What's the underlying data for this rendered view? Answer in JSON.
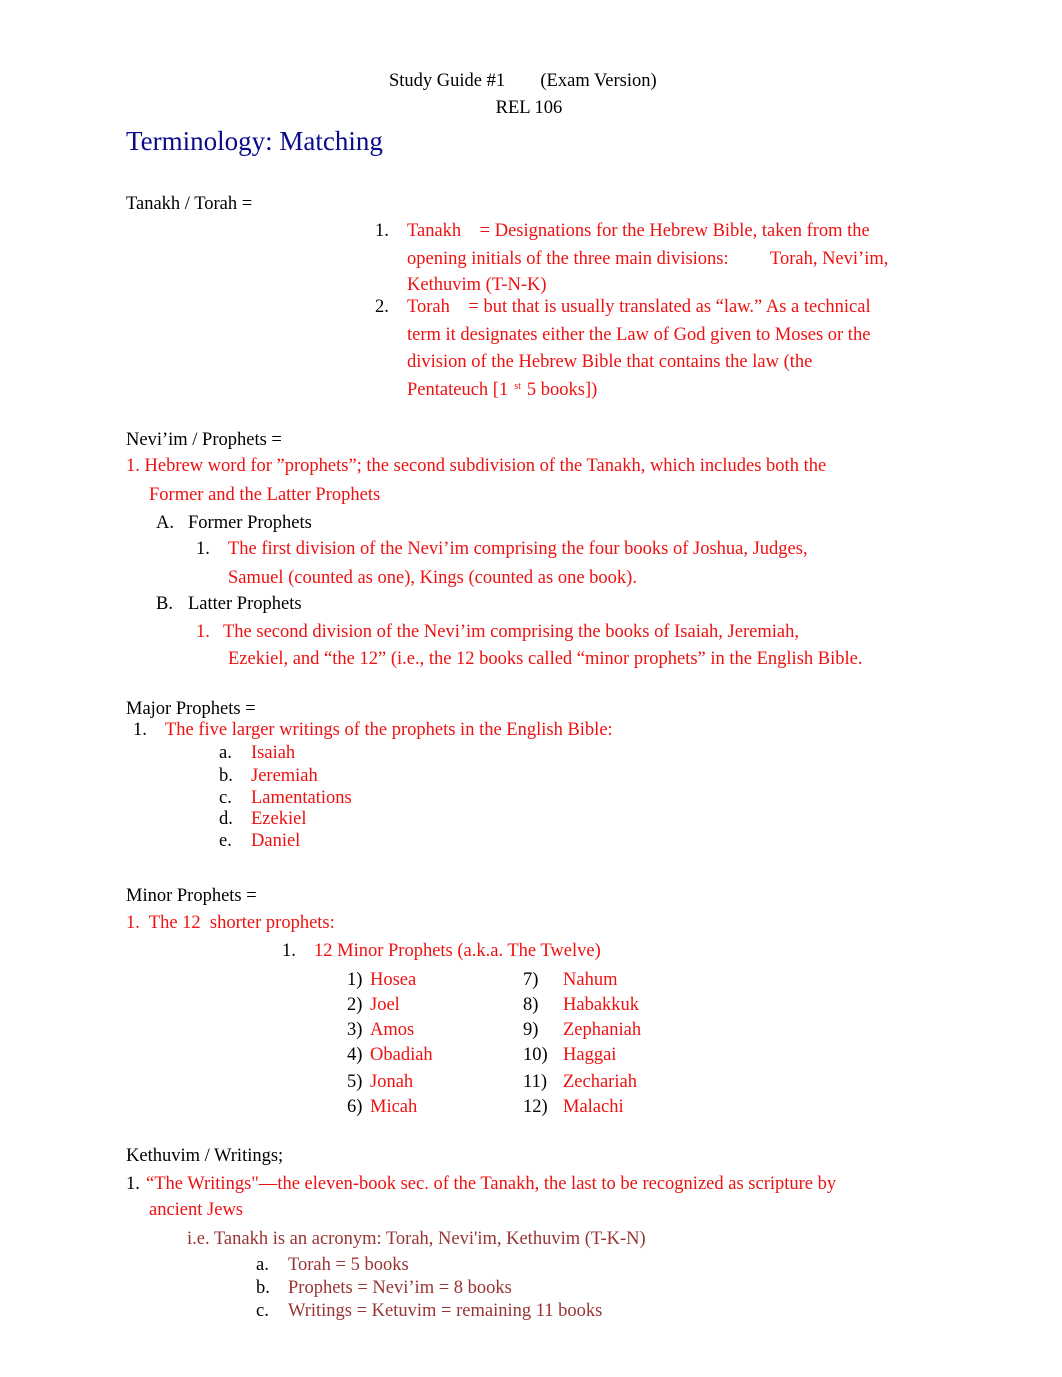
{
  "header": {
    "line1_a": "Study Guide #1",
    "line1_b": "(Exam Version)",
    "line2": "REL 106"
  },
  "section_title": "Terminology: Matching",
  "colors": {
    "title": "#0a0a8c",
    "answer": "#ee1111",
    "note": "#993333",
    "term": "#000000"
  },
  "tanakh": {
    "term": "Tanakh / Torah =",
    "items": [
      {
        "num": "1.",
        "lines": [
          "Tanakh    = Designations for the Hebrew Bible, taken from the",
          "opening initials of the three main divisions:         Torah, Nevi’im,",
          "Kethuvim (T-N-K)"
        ]
      },
      {
        "num": "2.",
        "lines": [
          "Torah    = but that is usually translated as “law.” As a technical",
          "term it designates either the Law of God given to Moses or the",
          "division of the Hebrew Bible that contains the law (the"
        ],
        "last_line_pre": "Pentateuch [1",
        "last_line_sup": "st",
        "last_line_post": "5 books])"
      }
    ]
  },
  "neviim": {
    "term": "Nevi’im / Prophets =",
    "def_line1": "1. Hebrew word for ”prophets”; the second subdivision of the Tanakh, which includes both the",
    "def_line2": "Former and the Latter Prophets",
    "sub": [
      {
        "letter": "A.",
        "label": "Former Prophets",
        "num": "1.",
        "lines": [
          "The first division of the Nevi’im comprising the four books of Joshua, Judges,",
          "Samuel (counted as one), Kings (counted as one book)."
        ]
      },
      {
        "letter": "B.",
        "label": "Latter Prophets",
        "num": "1.",
        "lines": [
          "The second division of the Nevi’im comprising the books of Isaiah, Jeremiah,",
          "Ezekiel, and “the 12” (i.e., the 12 books called “minor prophets” in the English Bible."
        ]
      }
    ]
  },
  "major": {
    "term": "Major Prophets =",
    "num": "1.",
    "def": "The five larger writings of the prophets in the English Bible:",
    "books": [
      {
        "letter": "a.",
        "name": "Isaiah"
      },
      {
        "letter": "b.",
        "name": "Jeremiah"
      },
      {
        "letter": "c.",
        "name": "Lamentations"
      },
      {
        "letter": "d.",
        "name": "Ezekiel"
      },
      {
        "letter": "e.",
        "name": "Daniel"
      }
    ]
  },
  "minor": {
    "term": "Minor Prophets =",
    "def": "1.  The 12  shorter prophets:",
    "sub_num": "1.",
    "sub_label": "12 Minor Prophets (a.k.a. The Twelve)",
    "books": [
      {
        "n": "1)",
        "name": "Hosea"
      },
      {
        "n": "2)",
        "name": "Joel"
      },
      {
        "n": "3)",
        "name": "Amos"
      },
      {
        "n": "4)",
        "name": "Obadiah"
      },
      {
        "n": "5)",
        "name": "Jonah"
      },
      {
        "n": "6)",
        "name": "Micah"
      },
      {
        "n": "7)",
        "name": "Nahum"
      },
      {
        "n": "8)",
        "name": "Habakkuk"
      },
      {
        "n": "9)",
        "name": "Zephaniah"
      },
      {
        "n": "10)",
        "name": "Haggai"
      },
      {
        "n": "11)",
        "name": "Zechariah"
      },
      {
        "n": "12)",
        "name": "Malachi"
      }
    ]
  },
  "kethuvim": {
    "term": "Kethuvim / Writings;",
    "num": "1.",
    "def_line1": "“The Writings\"—the eleven-book sec. of the Tanakh, the last to be recognized as scripture by",
    "def_line2": "ancient Jews",
    "note": "i.e. Tanakh is an acronym: Torah, Nevi'im, Kethuvim (T-K-N)",
    "counts": [
      {
        "letter": "a.",
        "text": "Torah = 5 books"
      },
      {
        "letter": "b.",
        "text": "Prophets = Nevi’im = 8 books"
      },
      {
        "letter": "c.",
        "text": "Writings = Ketuvim = remaining 11 books"
      }
    ]
  }
}
